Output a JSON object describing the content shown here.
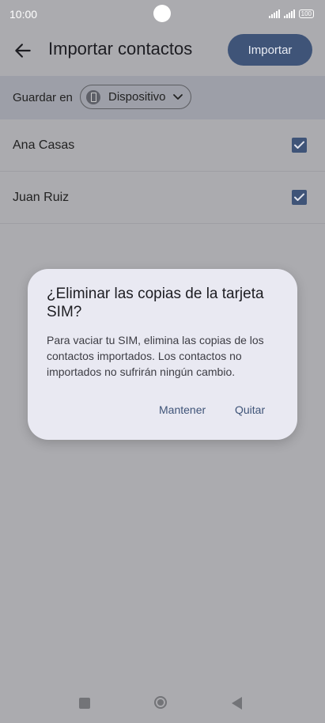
{
  "status_bar": {
    "time": "10:00",
    "battery": "100"
  },
  "app_bar": {
    "title": "Importar contactos",
    "import_button": "Importar"
  },
  "save_row": {
    "label": "Guardar en",
    "location": "Dispositivo"
  },
  "contacts": [
    {
      "name": "Ana Casas",
      "checked": true
    },
    {
      "name": "Juan Ruiz",
      "checked": true
    }
  ],
  "dialog": {
    "title": "¿Eliminar las copias de la tarjeta SIM?",
    "body": "Para vaciar tu SIM, elimina las copias de los contactos importados. Los contactos no importados no sufrirán ningún cambio.",
    "keep_button": "Mantener",
    "remove_button": "Quitar"
  },
  "colors": {
    "accent": "#3f5478",
    "scrim": "#ababaf",
    "dialog_bg": "#e9e9f2"
  }
}
